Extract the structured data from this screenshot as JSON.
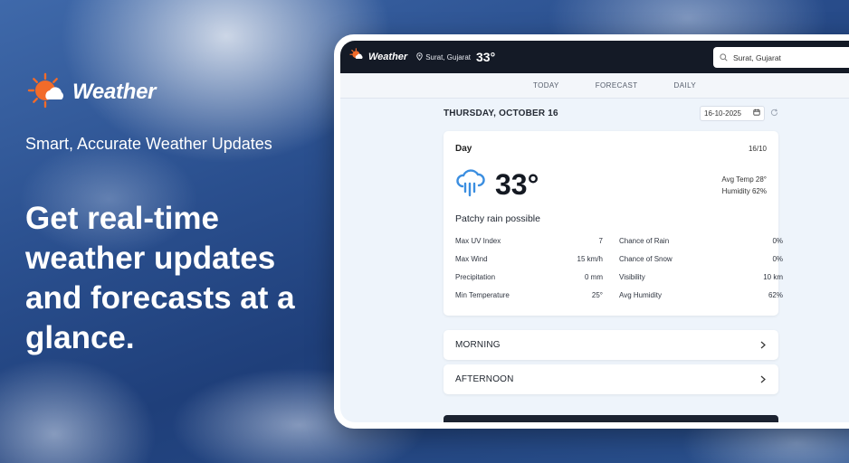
{
  "hero": {
    "brand": "Weather",
    "tagline": "Smart, Accurate Weather Updates",
    "headline": "Get real-time weather updates and forecasts at a glance."
  },
  "app": {
    "brand": "Weather",
    "location": "Surat, Gujarat",
    "current_temp": "33°",
    "search_value": "Surat, Gujarat",
    "tabs": [
      "TODAY",
      "FORECAST",
      "DAILY"
    ],
    "date_title": "THURSDAY, OCTOBER 16",
    "date_value": "16-10-2025",
    "day_card": {
      "label": "Day",
      "date": "16/10",
      "temp": "33°",
      "avg_temp": "Avg Temp 28°",
      "humidity": "Humidity 62%",
      "condition": "Patchy rain possible",
      "stats": [
        {
          "label": "Max UV Index",
          "value": "7"
        },
        {
          "label": "Chance of Rain",
          "value": "0%"
        },
        {
          "label": "Max Wind",
          "value": "15 km/h"
        },
        {
          "label": "Chance of Snow",
          "value": "0%"
        },
        {
          "label": "Precipitation",
          "value": "0 mm"
        },
        {
          "label": "Visibility",
          "value": "10 km"
        },
        {
          "label": "Min Temperature",
          "value": "25°"
        },
        {
          "label": "Avg Humidity",
          "value": "62%"
        }
      ]
    },
    "periods": [
      "MORNING",
      "AFTERNOON"
    ]
  },
  "colors": {
    "brand_orange": "#f26b2a",
    "topbar": "#141a26",
    "rain_icon_blue": "#3b8ee0",
    "background_blue": "#2a4f8e"
  },
  "icons": {
    "logo": "sun-cloud-icon",
    "location": "location-pin-icon",
    "search": "search-icon",
    "calendar": "calendar-icon",
    "refresh": "refresh-icon",
    "condition": "rain-cloud-icon",
    "chevron": "chevron-right-icon"
  }
}
